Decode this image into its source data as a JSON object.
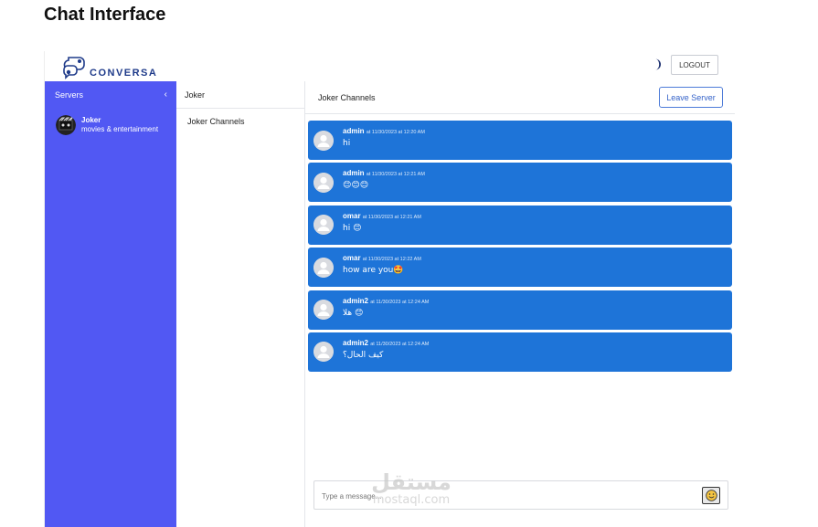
{
  "page": {
    "heading": "Chat Interface"
  },
  "topbar": {
    "logo_text": "CONVERSA",
    "logout_label": "LOGOUT"
  },
  "servers": {
    "header": "Servers",
    "items": [
      {
        "name": "Joker",
        "description": "movies & entertainment"
      }
    ]
  },
  "channels": {
    "header": "Joker",
    "items": [
      {
        "label": "Joker Channels"
      }
    ]
  },
  "main": {
    "title": "Joker Channels",
    "leave_label": "Leave Server",
    "messages": [
      {
        "author": "admin",
        "time": "at 11/30/2023 at 12:20 AM",
        "text": "hi"
      },
      {
        "author": "admin",
        "time": "at 11/30/2023 at 12:21 AM",
        "text": "😊😊😊"
      },
      {
        "author": "omar",
        "time": "at 11/30/2023 at 12:21 AM",
        "text": "hi 😊"
      },
      {
        "author": "omar",
        "time": "at 11/30/2023 at 12:22 AM",
        "text": "how are you🤩"
      },
      {
        "author": "admin2",
        "time": "at 11/30/2023 at 12:24 AM",
        "text": "هلا 😊"
      },
      {
        "author": "admin2",
        "time": "at 11/30/2023 at 12:24 AM",
        "text": "كيف الحال؟"
      }
    ],
    "composer_placeholder": "Type a message..."
  },
  "watermark": {
    "arabic": "مستقل",
    "latin": "mostaql.com"
  },
  "colors": {
    "sidebar": "#5158f3",
    "message_bg": "#1e74d8",
    "accent": "#3563c9"
  }
}
